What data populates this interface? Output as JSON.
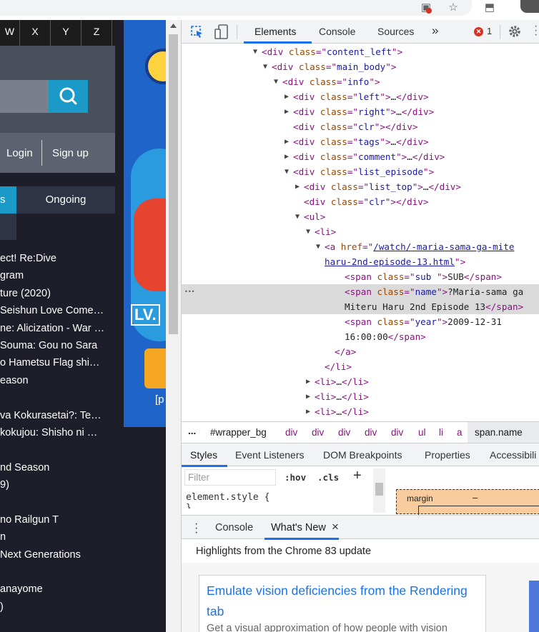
{
  "site": {
    "letters": [
      "W",
      "X",
      "Y",
      "Z"
    ],
    "login": "Login",
    "signup": "Sign up",
    "tabs": {
      "partial": "s",
      "ongoing": "Ongoing"
    },
    "titles": [
      "ect! Re:Dive",
      "gram",
      "ture (2020)",
      "Seishun Love Come…",
      "ne: Alicization - War …",
      "Souma: Gou no Sara",
      "o Hametsu Flag shi…",
      "eason",
      "",
      "va Kokurasetai?: Te…",
      "kokujou: Shisho ni …",
      "",
      "nd Season",
      "9)",
      "",
      "no Railgun T",
      "n",
      "Next Generations",
      "",
      "anayome",
      ")"
    ],
    "banner": {
      "lv": "LV.",
      "ptxt": "[p"
    }
  },
  "devtools": {
    "tabs": [
      "Elements",
      "Console",
      "Sources"
    ],
    "more": "»",
    "error_count": "1",
    "dom_lines": [
      {
        "indent": 112,
        "tri": "down",
        "parts": [
          [
            "tag",
            "<div "
          ],
          [
            "an",
            "class"
          ],
          [
            "tag",
            "=\""
          ],
          [
            "av",
            "content_left"
          ],
          [
            "tag",
            "\">"
          ]
        ]
      },
      {
        "indent": 126,
        "tri": "down",
        "parts": [
          [
            "tag",
            "<div "
          ],
          [
            "an",
            "class"
          ],
          [
            "tag",
            "=\""
          ],
          [
            "av",
            "main_body"
          ],
          [
            "tag",
            "\">"
          ]
        ]
      },
      {
        "indent": 141,
        "tri": "down",
        "parts": [
          [
            "tag",
            "<div "
          ],
          [
            "an",
            "class"
          ],
          [
            "tag",
            "=\""
          ],
          [
            "av",
            "info"
          ],
          [
            "tag",
            "\">"
          ]
        ]
      },
      {
        "indent": 156,
        "tri": "right",
        "parts": [
          [
            "tag",
            "<div "
          ],
          [
            "an",
            "class"
          ],
          [
            "tag",
            "=\""
          ],
          [
            "av",
            "left"
          ],
          [
            "tag",
            "\">"
          ],
          [
            "txt",
            "…"
          ],
          [
            "tag",
            "</div>"
          ]
        ]
      },
      {
        "indent": 156,
        "tri": "right",
        "parts": [
          [
            "tag",
            "<div "
          ],
          [
            "an",
            "class"
          ],
          [
            "tag",
            "=\""
          ],
          [
            "av",
            "right"
          ],
          [
            "tag",
            "\">"
          ],
          [
            "txt",
            "…"
          ],
          [
            "tag",
            "</div>"
          ]
        ]
      },
      {
        "indent": 156,
        "tri": "",
        "parts": [
          [
            "tag",
            "<div "
          ],
          [
            "an",
            "class"
          ],
          [
            "tag",
            "=\""
          ],
          [
            "av",
            "clr"
          ],
          [
            "tag",
            "\">"
          ],
          [
            "tag",
            "</div>"
          ]
        ]
      },
      {
        "indent": 156,
        "tri": "right",
        "parts": [
          [
            "tag",
            "<div "
          ],
          [
            "an",
            "class"
          ],
          [
            "tag",
            "=\""
          ],
          [
            "av",
            "tags"
          ],
          [
            "tag",
            "\">"
          ],
          [
            "txt",
            "…"
          ],
          [
            "tag",
            "</div>"
          ]
        ]
      },
      {
        "indent": 156,
        "tri": "right",
        "parts": [
          [
            "tag",
            "<div "
          ],
          [
            "an",
            "class"
          ],
          [
            "tag",
            "=\""
          ],
          [
            "av",
            "comment"
          ],
          [
            "tag",
            "\">"
          ],
          [
            "txt",
            "…"
          ],
          [
            "tag",
            "</div>"
          ]
        ]
      },
      {
        "indent": 156,
        "tri": "down",
        "parts": [
          [
            "tag",
            "<div "
          ],
          [
            "an",
            "class"
          ],
          [
            "tag",
            "=\""
          ],
          [
            "av",
            "list_episode"
          ],
          [
            "tag",
            "\">"
          ]
        ]
      },
      {
        "indent": 171,
        "tri": "right",
        "parts": [
          [
            "tag",
            "<div "
          ],
          [
            "an",
            "class"
          ],
          [
            "tag",
            "=\""
          ],
          [
            "av",
            "list_top"
          ],
          [
            "tag",
            "\">"
          ],
          [
            "txt",
            "…"
          ],
          [
            "tag",
            "</div>"
          ]
        ]
      },
      {
        "indent": 171,
        "tri": "",
        "parts": [
          [
            "tag",
            "<div "
          ],
          [
            "an",
            "class"
          ],
          [
            "tag",
            "=\""
          ],
          [
            "av",
            "clr"
          ],
          [
            "tag",
            "\">"
          ],
          [
            "tag",
            "</div>"
          ]
        ]
      },
      {
        "indent": 171,
        "tri": "down",
        "parts": [
          [
            "tag",
            "<ul>"
          ]
        ]
      },
      {
        "indent": 186,
        "tri": "down",
        "parts": [
          [
            "tag",
            "<li>"
          ]
        ]
      },
      {
        "indent": 200,
        "tri": "down",
        "parts": [
          [
            "tag",
            "<a "
          ],
          [
            "an",
            "href"
          ],
          [
            "tag",
            "=\""
          ],
          [
            "lnk",
            "/watch/-maria-sama-ga-mite"
          ]
        ]
      },
      {
        "indent": 200,
        "tri": "",
        "parts": [
          [
            "lnk",
            "haru-2nd-episode-13.html"
          ],
          [
            "tag",
            "\">"
          ]
        ]
      },
      {
        "indent": 228,
        "tri": "",
        "parts": [
          [
            "tag",
            "<span "
          ],
          [
            "an",
            "class"
          ],
          [
            "tag",
            "=\""
          ],
          [
            "av",
            "sub "
          ],
          [
            "tag",
            "\">"
          ],
          [
            "txt",
            "SUB"
          ],
          [
            "tag",
            "</span>"
          ]
        ]
      },
      {
        "indent": 228,
        "tri": "",
        "sel": true,
        "parts": [
          [
            "tag",
            "<span "
          ],
          [
            "an",
            "class"
          ],
          [
            "tag",
            "=\""
          ],
          [
            "av",
            "name"
          ],
          [
            "tag",
            "\">"
          ],
          [
            "txt",
            "?Maria-sama ga"
          ]
        ]
      },
      {
        "indent": 228,
        "tri": "",
        "sel": true,
        "parts": [
          [
            "txt",
            "Miteru Haru 2nd Episode 13"
          ],
          [
            "tag",
            "</span>"
          ]
        ]
      },
      {
        "indent": 228,
        "tri": "",
        "parts": [
          [
            "tag",
            "<span "
          ],
          [
            "an",
            "class"
          ],
          [
            "tag",
            "=\""
          ],
          [
            "av",
            "year"
          ],
          [
            "tag",
            "\">"
          ],
          [
            "txt",
            "2009-12-31"
          ]
        ]
      },
      {
        "indent": 228,
        "tri": "",
        "parts": [
          [
            "txt",
            "16:00:00"
          ],
          [
            "tag",
            "</span>"
          ]
        ]
      },
      {
        "indent": 214,
        "tri": "",
        "parts": [
          [
            "tag",
            "</a>"
          ]
        ]
      },
      {
        "indent": 200,
        "tri": "",
        "parts": [
          [
            "tag",
            "</li>"
          ]
        ]
      },
      {
        "indent": 186,
        "tri": "right",
        "parts": [
          [
            "tag",
            "<li>"
          ],
          [
            "txt",
            "…"
          ],
          [
            "tag",
            "</li>"
          ]
        ]
      },
      {
        "indent": 186,
        "tri": "right",
        "parts": [
          [
            "tag",
            "<li>"
          ],
          [
            "txt",
            "…"
          ],
          [
            "tag",
            "</li>"
          ]
        ]
      },
      {
        "indent": 186,
        "tri": "right",
        "parts": [
          [
            "tag",
            "<li>"
          ],
          [
            "txt",
            "…"
          ],
          [
            "tag",
            "</li>"
          ]
        ]
      }
    ],
    "breadcrumbs": {
      "ellipsis": "...",
      "root": "#wrapper_bg",
      "items": [
        "div",
        "div",
        "div",
        "div",
        "div",
        "ul",
        "li",
        "a"
      ],
      "selected": "span.name"
    },
    "panel_tabs": [
      "Styles",
      "Event Listeners",
      "DOM Breakpoints",
      "Properties",
      "Accessibili"
    ],
    "filter_placeholder": "Filter",
    "hov": ":hov",
    "cls": ".cls",
    "plus": "+",
    "element_style": "element.style {",
    "element_style_close": "}",
    "box_model": {
      "margin_label": "margin",
      "margin_value": "–"
    },
    "drawer": {
      "tabs": [
        "Console",
        "What's New"
      ],
      "close": "×",
      "highlights": "Highlights from the Chrome 83 update",
      "card_title": "Emulate vision deficiencies from the Rendering tab",
      "card_desc": "Get a visual approximation of how people with vision"
    }
  }
}
